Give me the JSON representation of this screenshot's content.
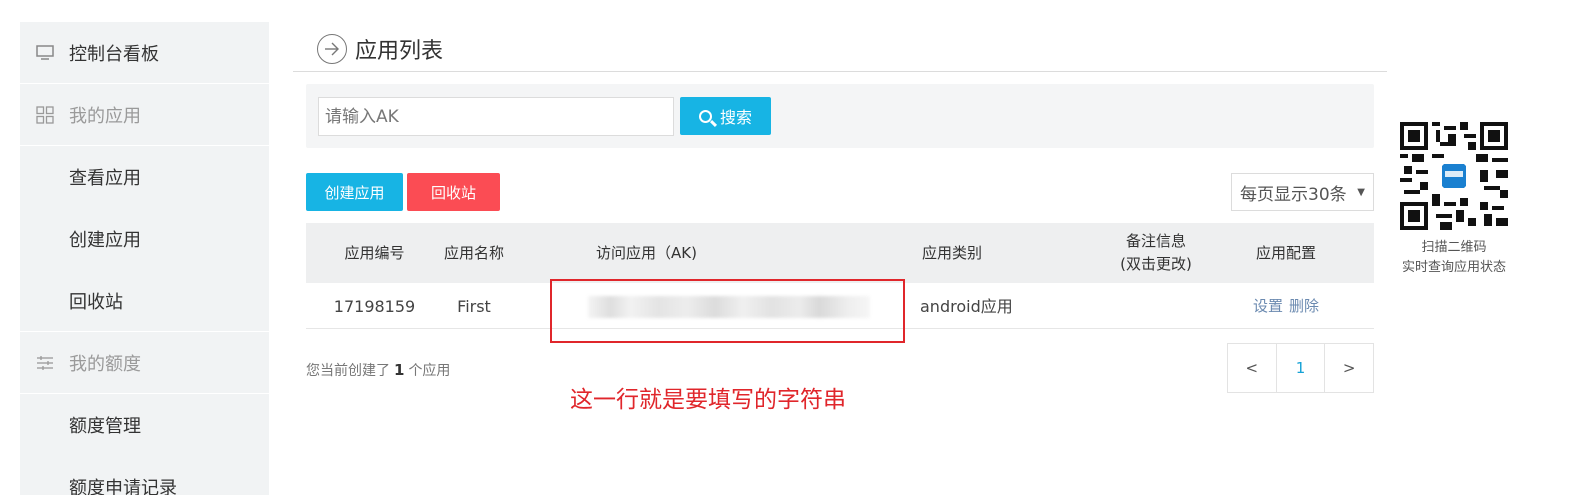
{
  "sidebar": {
    "dashboard": "控制台看板",
    "my_apps": "我的应用",
    "view_apps": "查看应用",
    "create_app": "创建应用",
    "recycle": "回收站",
    "my_quota": "我的额度",
    "quota_manage": "额度管理",
    "quota_history": "额度申请记录"
  },
  "main": {
    "title": "应用列表",
    "search_placeholder": "请输入AK",
    "search_button": "搜索",
    "create_button": "创建应用",
    "recycle_button": "回收站",
    "page_size": "每页显示30条"
  },
  "table": {
    "headers": [
      "应用编号",
      "应用名称",
      "访问应用（AK)",
      "应用类别",
      "备注信息\n(双击更改)",
      "应用配置"
    ],
    "rows": [
      {
        "id": "17198159",
        "name": "First",
        "ak": "",
        "category": "android应用",
        "note": "",
        "action_set": "设置",
        "action_delete": "删除"
      }
    ]
  },
  "footer": {
    "count_prefix": "您当前创建了",
    "count": "1",
    "count_suffix": "个应用",
    "pager_prev": "<",
    "pager_current": "1",
    "pager_next": ">"
  },
  "annotation": "这一行就是要填写的字符串",
  "qr": {
    "caption_line1": "扫描二维码",
    "caption_line2": "实时查询应用状态"
  },
  "colors": {
    "primary": "#17b4e4",
    "danger": "#fb4c54",
    "annotation_red": "#e0262b"
  }
}
